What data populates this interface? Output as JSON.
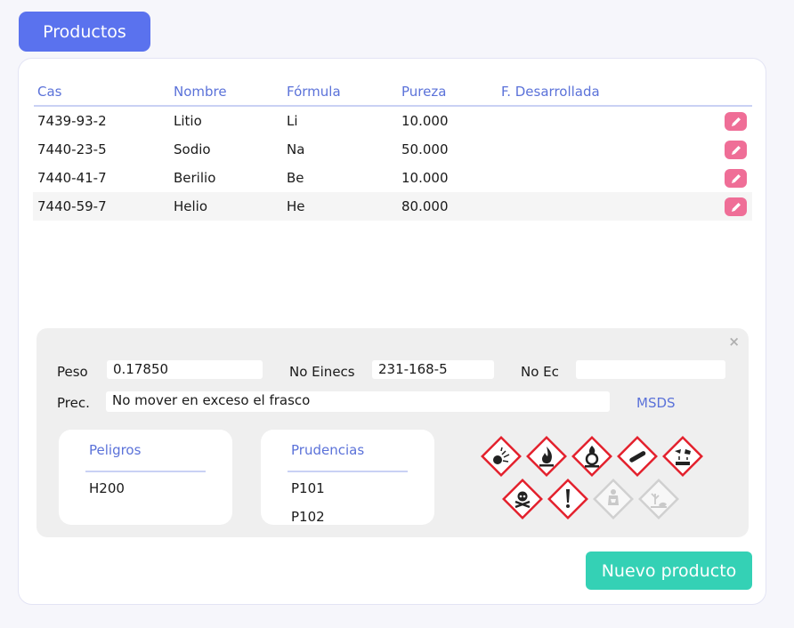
{
  "header": {
    "title": "Productos"
  },
  "table": {
    "columns": [
      "Cas",
      "Nombre",
      "Fórmula",
      "Pureza",
      "F. Desarrollada"
    ],
    "rows": [
      {
        "cas": "7439-93-2",
        "nombre": "Litio",
        "formula": "Li",
        "pureza": "10.000",
        "f_desarrollada": ""
      },
      {
        "cas": "7440-23-5",
        "nombre": "Sodio",
        "formula": "Na",
        "pureza": "50.000",
        "f_desarrollada": ""
      },
      {
        "cas": "7440-41-7",
        "nombre": "Berilio",
        "formula": "Be",
        "pureza": "10.000",
        "f_desarrollada": ""
      },
      {
        "cas": "7440-59-7",
        "nombre": "Helio",
        "formula": "He",
        "pureza": "80.000",
        "f_desarrollada": ""
      }
    ]
  },
  "detail": {
    "close": "×",
    "peso_label": "Peso",
    "peso_value": "0.17850",
    "einecs_label": "No Einecs",
    "einecs_value": "231-168-5",
    "ec_label": "No Ec",
    "ec_value": "",
    "prec_label": "Prec.",
    "prec_value": "No mover en exceso el frasco",
    "msds_link": "MSDS",
    "peligros": {
      "title": "Peligros",
      "items": [
        "H200"
      ]
    },
    "prudencias": {
      "title": "Prudencias",
      "items": [
        "P101",
        "P102"
      ]
    },
    "pictograms": [
      {
        "icon": "explosive-icon",
        "active": true
      },
      {
        "icon": "flammable-icon",
        "active": true
      },
      {
        "icon": "oxidizing-icon",
        "active": true
      },
      {
        "icon": "gas-cylinder-icon",
        "active": true
      },
      {
        "icon": "corrosive-icon",
        "active": true
      },
      {
        "icon": "skull-crossbones-icon",
        "active": true
      },
      {
        "icon": "exclamation-icon",
        "active": true
      },
      {
        "icon": "health-hazard-icon",
        "active": false
      },
      {
        "icon": "environment-icon",
        "active": false
      }
    ]
  },
  "footer": {
    "new_button": "Nuevo producto"
  },
  "colors": {
    "primary": "#5a72ee",
    "accent_text": "#5b72d9",
    "edit": "#ef6e97",
    "success": "#34d1b5",
    "hazard_red": "#e3212d"
  }
}
